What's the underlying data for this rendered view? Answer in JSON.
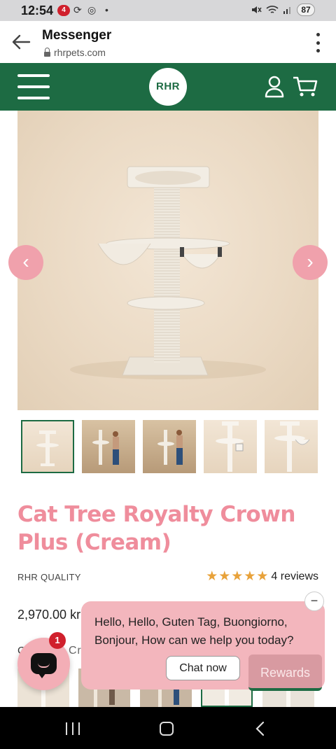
{
  "status_bar": {
    "time": "12:54",
    "notification_badge": "4",
    "battery": "87",
    "icons": [
      "notification-badge-icon",
      "sync-icon",
      "chrome-icon",
      "dot-icon",
      "mute-icon",
      "wifi-icon",
      "signal-icon",
      "battery-icon"
    ]
  },
  "browser": {
    "title": "Messenger",
    "url": "rhrpets.com",
    "icons": [
      "back-arrow-icon",
      "lock-icon",
      "more-vert-icon"
    ]
  },
  "site_header": {
    "logo_text": "RHR",
    "brand_color": "#1d6b43",
    "icons": [
      "hamburger-menu-icon",
      "user-icon",
      "cart-icon"
    ]
  },
  "gallery": {
    "prev_symbol": "‹",
    "next_symbol": "›",
    "thumbnail_count": 5,
    "active_index": 0
  },
  "product": {
    "title": "Cat Tree Royalty Crown Plus (Cream)",
    "title_color": "#ef8d9c",
    "brand": "RHR QUALITY",
    "rating_stars": 5,
    "reviews": "4 reviews",
    "price_visible": "2,970.00 kr",
    "color_label_visible": "C",
    "color_value": "Cream / Beige"
  },
  "chat_widget": {
    "message": "Hello, Hello, Guten Tag, Buongiorno, Bonjour, How can we help you today?",
    "close_symbol": "−",
    "chat_now_label": "Chat now",
    "rewards_label": "Rewards",
    "unread_count": "1"
  }
}
